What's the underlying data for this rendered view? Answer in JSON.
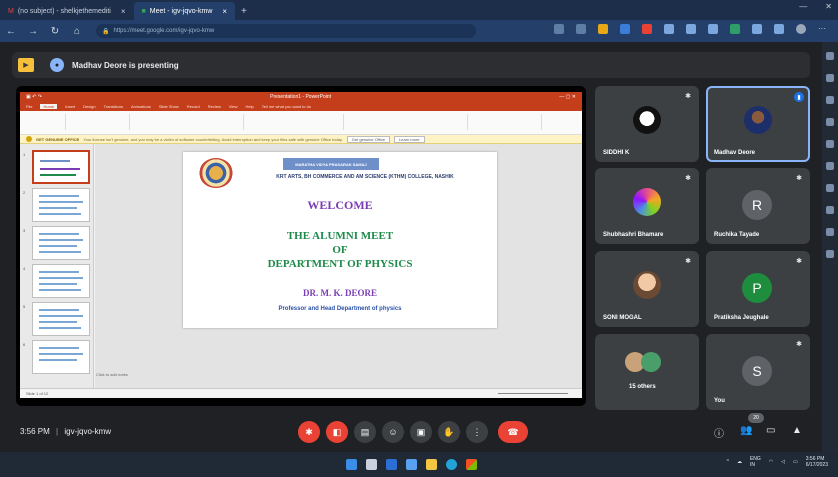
{
  "browser": {
    "tabs": [
      {
        "label": "(no subject) - shelkjethemediti",
        "active": false
      },
      {
        "label": "Meet - igv-jqvo-kmw",
        "active": true
      }
    ],
    "url": "https://meet.google.com/igv-jqvo-kmw"
  },
  "banner": {
    "presenting_text": "Madhav Deore is presenting"
  },
  "presentation": {
    "app_title": "Presentation1 - PowerPoint",
    "ribbon_tabs": [
      "File",
      "Home",
      "Insert",
      "Design",
      "Transitions",
      "Animations",
      "Slide Show",
      "Record",
      "Review",
      "View",
      "Help",
      "Tell me what you want to do"
    ],
    "notice_title": "GET GENUINE OFFICE",
    "notice_text": "Your license isn't genuine, and you may be a victim of software counterfeiting. Avoid interruption and keep your files safe with genuine Office today.",
    "notice_btn1": "Get genuine Office",
    "notice_btn2": "Learn more",
    "notes_placeholder": "Click to add notes",
    "status_text": "Slide 1 of 12",
    "slide": {
      "header": "MARATHA VIDYA PRASARAK SAMAJ",
      "college": "KRT ARTS, BH COMMERCE AND AM SCIENCE (KTHM) COLLEGE, NASHIK",
      "welcome": "WELCOME",
      "line1": "THE ALUMNI MEET",
      "line2": "OF",
      "line3": "DEPARTMENT  OF PHYSICS",
      "name": "DR. M. K. DEORE",
      "designation": "Professor and Head Department of physics"
    }
  },
  "participants": [
    {
      "name": "SIDDHI K",
      "type": "image",
      "muted": true,
      "speaking": false
    },
    {
      "name": "Madhav Deore",
      "type": "image",
      "muted": false,
      "speaking": true
    },
    {
      "name": "Shubhashri Bhamare",
      "type": "image",
      "muted": true,
      "speaking": false
    },
    {
      "name": "Ruchika Tayade",
      "type": "letter",
      "letter": "R",
      "color": "#5f6368",
      "muted": true,
      "speaking": false
    },
    {
      "name": "SONI MOGAL",
      "type": "image",
      "muted": true,
      "speaking": false
    },
    {
      "name": "Pratiksha Jeughale",
      "type": "letter",
      "letter": "P",
      "color": "#1e8e3e",
      "muted": true,
      "speaking": false
    },
    {
      "name": "15 others",
      "type": "group",
      "muted": false,
      "speaking": false
    },
    {
      "name": "You",
      "type": "letter",
      "letter": "S",
      "color": "#5f6368",
      "muted": true,
      "speaking": false
    }
  ],
  "meeting": {
    "time": "3:56 PM",
    "code": "igv-jqvo-kmw",
    "separator": "|",
    "people_count": "20"
  },
  "taskbar": {
    "lang": "ENG",
    "lang2": "IN",
    "clock": "3:56 PM",
    "date": "6/17/2023"
  },
  "colors": {
    "meet_bg": "#202124",
    "tile_bg": "#3c4043",
    "hangup_red": "#ea4335",
    "ppt_red": "#c43e1c"
  }
}
